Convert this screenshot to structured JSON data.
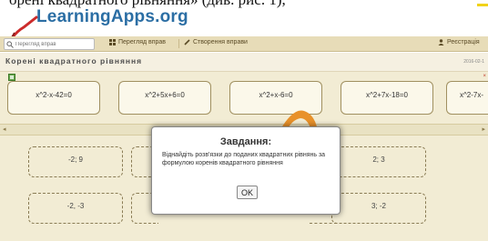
{
  "document": {
    "caption": "орені квадратного рівняння» (див. рис. 1),"
  },
  "logo": {
    "text": "LearningApps.org"
  },
  "navbar": {
    "search_placeholder": "Перегляд вправ",
    "browse_label": "Перегляд вправ",
    "create_label": "Створення вправи",
    "register_label": "Реєстрація"
  },
  "page": {
    "title": "Корені квадратного рівняння",
    "date": "2016-02-1"
  },
  "equations": [
    {
      "label": "x^2-x-42=0"
    },
    {
      "label": "x^2+5x+6=0"
    },
    {
      "label": "x^2+x-6=0"
    },
    {
      "label": "x^2+7x-18=0"
    },
    {
      "label": "x^2-7x-"
    }
  ],
  "answers": [
    {
      "label": "-2; 9"
    },
    {
      "label": "2; 3"
    },
    {
      "label": "-2, -3"
    },
    {
      "label": "3; -2"
    }
  ],
  "modal": {
    "title": "Завдання:",
    "text": "Віднайдіть розв'язки до поданих квадратних рівнянь за формулою коренів квадратного рівняння",
    "ok_label": "OK"
  },
  "colors": {
    "accent": "#2b6ea4",
    "navbar_bg": "#e7dcb8",
    "app_bg": "#f2ecd4",
    "swoosh": "#e8912a"
  }
}
